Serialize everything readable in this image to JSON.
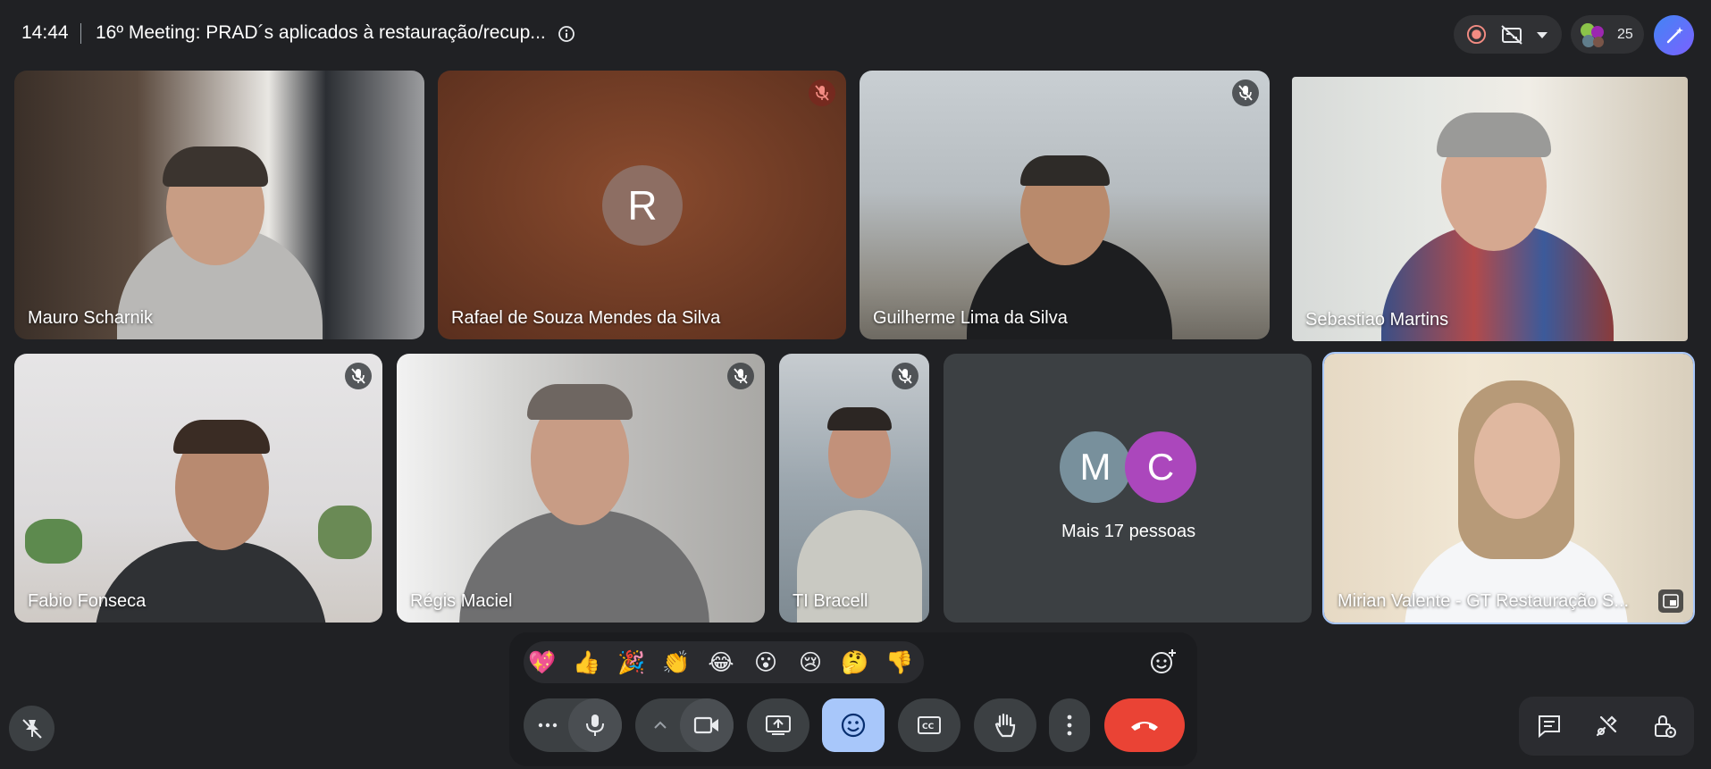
{
  "topbar": {
    "time": "14:44",
    "title": "16º Meeting: PRAD´s aplicados à restauração/recup...",
    "participant_count": "25"
  },
  "tiles": {
    "mauro": {
      "name": "Mauro Scharnik"
    },
    "rafael": {
      "name": "Rafael de Souza Mendes da Silva",
      "initial": "R",
      "muted": true
    },
    "guilherme": {
      "name": "Guilherme Lima da Silva",
      "muted": true
    },
    "sebastiao": {
      "name": "Sebastiao Martins"
    },
    "fabio": {
      "name": "Fabio Fonseca",
      "muted": true
    },
    "regis": {
      "name": "Régis Maciel",
      "muted": true
    },
    "ti": {
      "name": "TI Bracell",
      "muted": true
    },
    "others": {
      "initials": [
        "M",
        "C"
      ],
      "label": "Mais 17 pessoas"
    },
    "mirian": {
      "name": "Mirian Valente - GT Restauração S..."
    }
  },
  "reactions": [
    "💖",
    "👍",
    "🎉",
    "👏",
    "😂",
    "😮",
    "😢",
    "🤔",
    "👎"
  ],
  "colors": {
    "background": "#202124",
    "control": "#3c4043",
    "active_reactions": "#a8c7fa",
    "end_call": "#ea4335",
    "avatar_r": "#8d6e63",
    "avatar_m": "#78909c",
    "avatar_c": "#ab47bc"
  },
  "icons": {
    "info": "info-icon",
    "record": "record-icon",
    "captions_off": "captions-off-icon",
    "people": "people-icon",
    "gemini": "gemini-icon",
    "mic_off": "mic-off-icon",
    "more_options": "more-horizontal-icon",
    "microphone": "microphone-icon",
    "camera": "camera-icon",
    "present": "present-screen-icon",
    "emoji": "emoji-icon",
    "captions": "captions-icon",
    "hand": "raise-hand-icon",
    "more_vert": "more-vertical-icon",
    "hangup": "hangup-icon",
    "chat": "chat-icon",
    "activities": "activities-icon",
    "host_controls": "host-controls-icon",
    "unpin": "unpin-icon"
  }
}
